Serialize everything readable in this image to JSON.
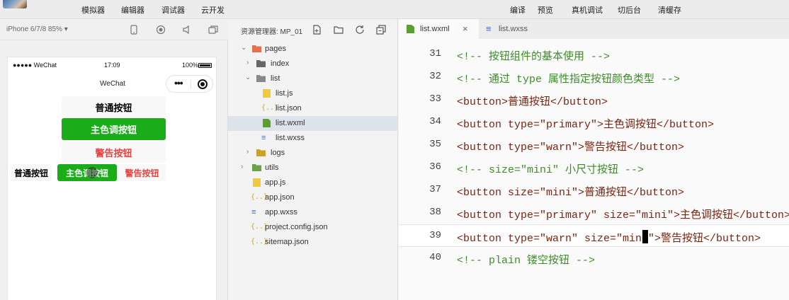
{
  "top_toolbar": {
    "left_items": [
      "模拟器",
      "编辑器",
      "调试器",
      "云开发"
    ],
    "right_items": [
      "编译",
      "预览",
      "真机调试",
      "切后台",
      "清缓存"
    ]
  },
  "simulator": {
    "device": "iPhone 6/7/8 85% ▾",
    "status_bar": {
      "carrier": "●●●●● WeChat",
      "time": "17:09",
      "battery": "100%"
    },
    "nav_title": "WeChat",
    "capsule": {
      "more": "•••"
    },
    "buttons": {
      "default": "普通按钮",
      "primary": "主色调按钮",
      "warn": "警告按钮",
      "mini_default": "普通按钮",
      "mini_primary": "主色调按钮",
      "mini_warn": "警告按钮"
    }
  },
  "explorer": {
    "title": "资源管理器: MP_01",
    "tree": [
      {
        "label": "pages",
        "type": "folder",
        "expanded": true
      },
      {
        "label": "index",
        "type": "folder",
        "expanded": false
      },
      {
        "label": "list",
        "type": "folder",
        "expanded": true
      },
      {
        "label": "list.js",
        "type": "js"
      },
      {
        "label": "list.json",
        "type": "json"
      },
      {
        "label": "list.wxml",
        "type": "wxml",
        "selected": true
      },
      {
        "label": "list.wxss",
        "type": "wxss"
      },
      {
        "label": "logs",
        "type": "folder",
        "expanded": false
      },
      {
        "label": "utils",
        "type": "folder",
        "expanded": false
      },
      {
        "label": "app.js",
        "type": "js"
      },
      {
        "label": "app.json",
        "type": "json"
      },
      {
        "label": "app.wxss",
        "type": "wxss"
      },
      {
        "label": "project.config.json",
        "type": "json"
      },
      {
        "label": "sitemap.json",
        "type": "json"
      }
    ]
  },
  "editor": {
    "tabs": [
      {
        "label": "list.wxml",
        "active": true,
        "close": "×"
      },
      {
        "label": "list.wxss",
        "active": false
      }
    ],
    "lines": [
      {
        "num": "31",
        "text": "<!-- 按钮组件的基本使用 -->"
      },
      {
        "num": "32",
        "text": "<!-- 通过 type 属性指定按钮颜色类型 -->"
      },
      {
        "num": "33",
        "text": "<button>普通按钮</button>"
      },
      {
        "num": "34",
        "text": "<button type=\"primary\">主色调按钮</button>"
      },
      {
        "num": "35",
        "text": "<button type=\"warn\">警告按钮</button>"
      },
      {
        "num": "36",
        "text": "<!-- size=\"mini\" 小尺寸按钮 -->"
      },
      {
        "num": "37",
        "text": "<button size=\"mini\">普通按钮</button>"
      },
      {
        "num": "38",
        "text": "<button type=\"primary\" size=\"mini\">主色调按钮</button>"
      },
      {
        "num": "39",
        "text": "<button type=\"warn\" size=\"mini\">警告按钮</button>",
        "current": true
      },
      {
        "num": "40",
        "text": "<!-- plain 镂空按钮 -->"
      }
    ]
  },
  "colors": {
    "primary_green": "#1aad19",
    "warn_red": "#e64340",
    "comment_green": "#3d8d27",
    "tag_color": "#7a2410",
    "attr_color": "#3a4ea5",
    "value_color": "#1c2b8c"
  }
}
